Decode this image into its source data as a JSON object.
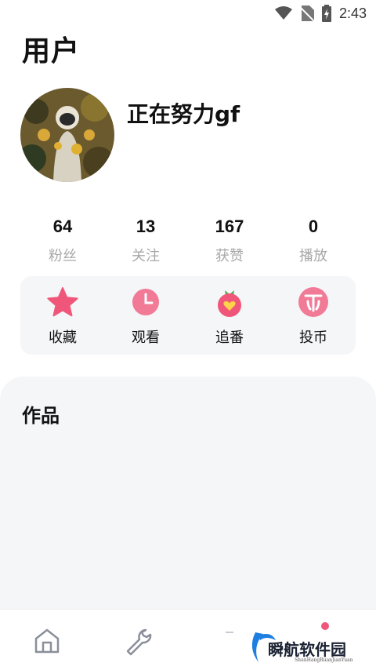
{
  "status_bar": {
    "time": "2:43",
    "icons": [
      "wifi-icon",
      "no-sim-icon",
      "battery-icon"
    ]
  },
  "page": {
    "title": "用户"
  },
  "profile": {
    "username": "正在努力gf"
  },
  "stats": [
    {
      "value": "64",
      "label": "粉丝"
    },
    {
      "value": "13",
      "label": "关注"
    },
    {
      "value": "167",
      "label": "获赞"
    },
    {
      "value": "0",
      "label": "播放"
    }
  ],
  "actions": [
    {
      "label": "收藏",
      "icon": "star-icon"
    },
    {
      "label": "观看",
      "icon": "clock-icon"
    },
    {
      "label": "追番",
      "icon": "strawberry-heart-icon"
    },
    {
      "label": "投币",
      "icon": "coin-icon"
    }
  ],
  "works": {
    "title": "作品"
  },
  "bottom_nav": {
    "items": [
      "home-icon",
      "wrench-icon",
      "message-icon",
      "profile-icon"
    ]
  },
  "watermark": {
    "text": "瞬航软件园",
    "subtext": "ShunHangRuanJianYuan"
  },
  "colors": {
    "accent": "#f0567a",
    "panel": "#f5f6f8",
    "muted": "#a8a8a8"
  }
}
